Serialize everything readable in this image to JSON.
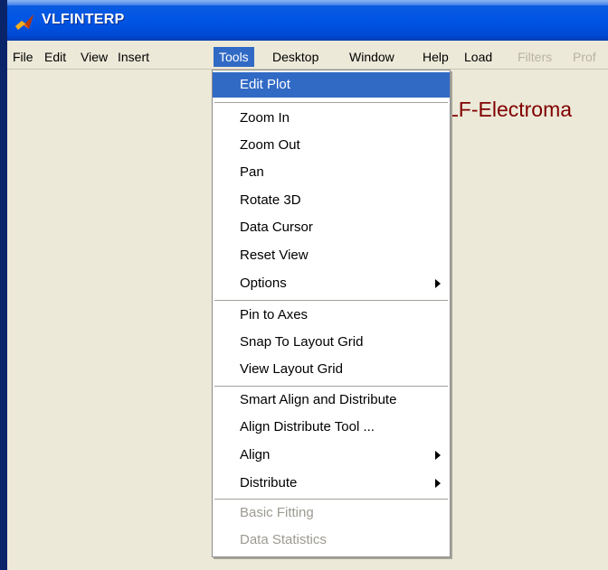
{
  "window": {
    "title": "VLFINTERP",
    "icon": "matlab-icon"
  },
  "menubar": {
    "items": [
      {
        "label": "File",
        "state": "normal"
      },
      {
        "label": "Edit",
        "state": "normal"
      },
      {
        "label": "View",
        "state": "normal"
      },
      {
        "label": "Insert",
        "state": "normal"
      },
      {
        "label": "Tools",
        "state": "active"
      },
      {
        "label": "Desktop",
        "state": "normal"
      },
      {
        "label": "Window",
        "state": "normal"
      },
      {
        "label": "Help",
        "state": "normal"
      },
      {
        "label": "Load",
        "state": "normal"
      },
      {
        "label": "Filters",
        "state": "disabled"
      },
      {
        "label": "Prof",
        "state": "disabled"
      }
    ]
  },
  "plot": {
    "title_fragment": "LF-Electroma"
  },
  "tools_menu": {
    "items": [
      {
        "label": "Edit Plot",
        "highlighted": true
      },
      {
        "label": "Zoom In"
      },
      {
        "label": "Zoom Out"
      },
      {
        "label": "Pan"
      },
      {
        "label": "Rotate 3D"
      },
      {
        "label": "Data Cursor"
      },
      {
        "label": "Reset View"
      },
      {
        "label": "Options",
        "submenu": true
      },
      {
        "label": "Pin to Axes"
      },
      {
        "label": "Snap To Layout Grid"
      },
      {
        "label": "View Layout Grid"
      },
      {
        "label": "Smart Align and Distribute"
      },
      {
        "label": "Align Distribute Tool ..."
      },
      {
        "label": "Align",
        "submenu": true
      },
      {
        "label": "Distribute",
        "submenu": true
      },
      {
        "label": "Basic Fitting",
        "disabled": true
      },
      {
        "label": "Data Statistics",
        "disabled": true
      }
    ]
  },
  "colors": {
    "titlebar": "#0055e5",
    "highlight": "#316ac5",
    "plot_title": "#800000",
    "background": "#ece9d8"
  }
}
